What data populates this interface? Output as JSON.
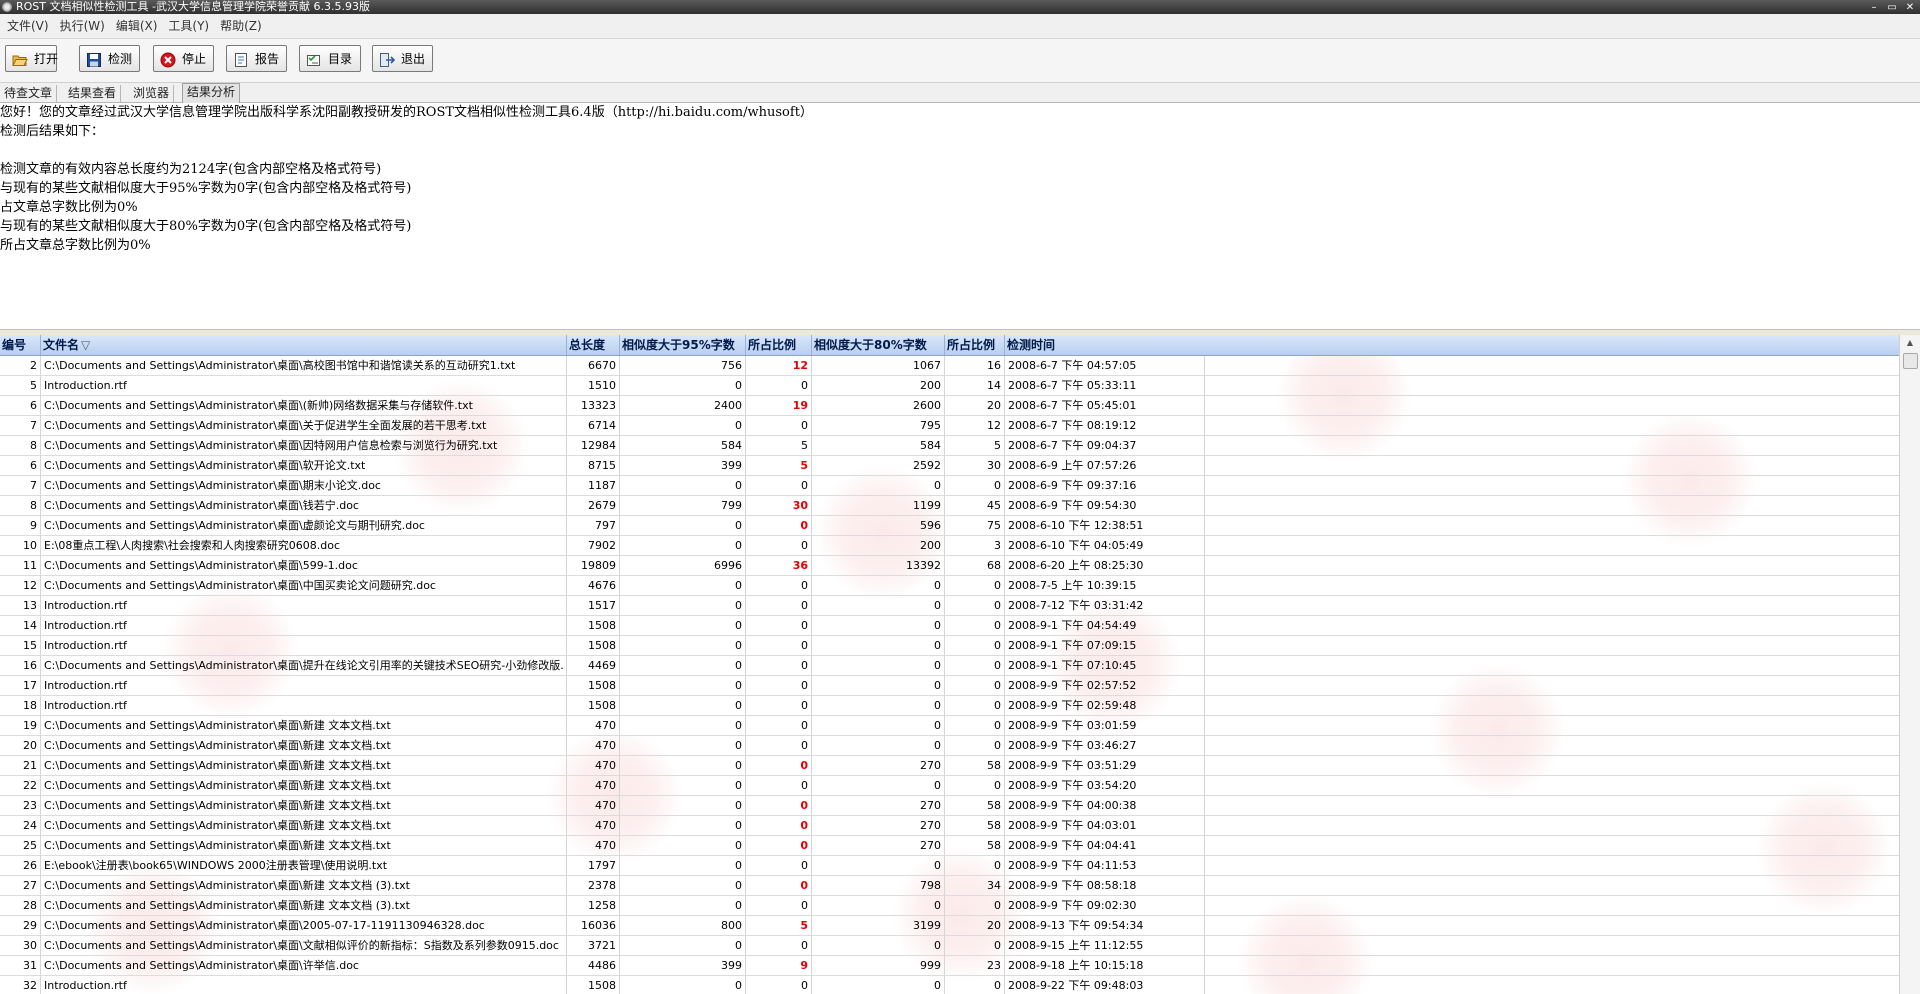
{
  "window": {
    "title": "ROST 文档相似性检测工具 -武汉大学信息管理学院荣誉贡献 6.3.5.93版",
    "controls": [
      "–",
      "▭",
      "✕"
    ]
  },
  "menu": [
    {
      "name": "file",
      "label": "文件(V)"
    },
    {
      "name": "execute",
      "label": "执行(W)"
    },
    {
      "name": "edit",
      "label": "编辑(X)"
    },
    {
      "name": "tools",
      "label": "工具(Y)"
    },
    {
      "name": "help",
      "label": "帮助(Z)"
    }
  ],
  "toolbar": [
    {
      "name": "open",
      "label": "打开",
      "icon": "folder-open-icon"
    },
    {
      "name": "detect",
      "label": "检测",
      "icon": "floppy-icon"
    },
    {
      "name": "stop",
      "label": "停止",
      "icon": "stop-icon"
    },
    {
      "name": "report",
      "label": "报告",
      "icon": "report-icon"
    },
    {
      "name": "catalog",
      "label": "目录",
      "icon": "catalog-icon"
    },
    {
      "name": "exit",
      "label": "退出",
      "icon": "exit-icon"
    }
  ],
  "tabs": [
    {
      "name": "pending",
      "label": "待查文章",
      "active": false
    },
    {
      "name": "results-view",
      "label": "结果查看",
      "active": false
    },
    {
      "name": "browser",
      "label": "浏览器",
      "active": false
    },
    {
      "name": "results-analysis",
      "label": "结果分析",
      "active": true
    }
  ],
  "result_text": [
    "您好！您的文章经过武汉大学信息管理学院出版科学系沈阳副教授研发的ROST文档相似性检测工具6.4版（http://hi.baidu.com/whusoft）",
    "检测后结果如下：",
    "",
    "检测文章的有效内容总长度约为2124字(包含内部空格及格式符号)",
    "与现有的某些文献相似度大于95%字数为0字(包含内部空格及格式符号)",
    "占文章总字数比例为0%",
    "与现有的某些文献相似度大于80%字数为0字(包含内部空格及格式符号)",
    "所占文章总字数比例为0%"
  ],
  "table": {
    "columns": [
      "编号",
      "文件名",
      "总长度",
      "相似度大于95%字数",
      "所占比例",
      "相似度大于80%字数",
      "所占比例",
      "检测时间"
    ],
    "sort_indicator": "▽",
    "highlight_color": "#e60000",
    "rows": [
      [
        "2",
        "C:\\Documents and Settings\\Administrator\\桌面\\高校图书馆中和谐馆读关系的互动研究1.txt",
        "6670",
        "756",
        "12",
        "1067",
        "16",
        "2008-6-7 下午 04:57:05",
        true
      ],
      [
        "5",
        "Introduction.rtf",
        "1510",
        "0",
        "0",
        "200",
        "14",
        "2008-6-7 下午 05:33:11",
        false
      ],
      [
        "6",
        "C:\\Documents and Settings\\Administrator\\桌面\\(新帅)网络数据采集与存储软件.txt",
        "13323",
        "2400",
        "19",
        "2600",
        "20",
        "2008-6-7 下午 05:45:01",
        true
      ],
      [
        "7",
        "C:\\Documents and Settings\\Administrator\\桌面\\关于促进学生全面发展的若干思考.txt",
        "6714",
        "0",
        "0",
        "795",
        "12",
        "2008-6-7 下午 08:19:12",
        false
      ],
      [
        "8",
        "C:\\Documents and Settings\\Administrator\\桌面\\因特网用户信息检索与浏览行为研究.txt",
        "12984",
        "584",
        "5",
        "584",
        "5",
        "2008-6-7 下午 09:04:37",
        false
      ],
      [
        "6",
        "C:\\Documents and Settings\\Administrator\\桌面\\软开论文.txt",
        "8715",
        "399",
        "5",
        "2592",
        "30",
        "2008-6-9 上午 07:57:26",
        true
      ],
      [
        "7",
        "C:\\Documents and Settings\\Administrator\\桌面\\期末小论文.doc",
        "1187",
        "0",
        "0",
        "0",
        "0",
        "2008-6-9 下午 09:37:16",
        false
      ],
      [
        "8",
        "C:\\Documents and Settings\\Administrator\\桌面\\钱若宁.doc",
        "2679",
        "799",
        "30",
        "1199",
        "45",
        "2008-6-9 下午 09:54:30",
        true
      ],
      [
        "9",
        "C:\\Documents and Settings\\Administrator\\桌面\\虚颜论文与期刊研究.doc",
        "797",
        "0",
        "0",
        "596",
        "75",
        "2008-6-10 下午 12:38:51",
        true
      ],
      [
        "10",
        "E:\\08重点工程\\人肉搜索\\社会搜索和人肉搜索研究0608.doc",
        "7902",
        "0",
        "0",
        "200",
        "3",
        "2008-6-10 下午 04:05:49",
        false
      ],
      [
        "11",
        "C:\\Documents and Settings\\Administrator\\桌面\\599-1.doc",
        "19809",
        "6996",
        "36",
        "13392",
        "68",
        "2008-6-20 上午 08:25:30",
        true
      ],
      [
        "12",
        "C:\\Documents and Settings\\Administrator\\桌面\\中国买卖论文问题研究.doc",
        "4676",
        "0",
        "0",
        "0",
        "0",
        "2008-7-5 上午 10:39:15",
        false
      ],
      [
        "13",
        "Introduction.rtf",
        "1517",
        "0",
        "0",
        "0",
        "0",
        "2008-7-12 下午 03:31:42",
        false
      ],
      [
        "14",
        "Introduction.rtf",
        "1508",
        "0",
        "0",
        "0",
        "0",
        "2008-9-1 下午 04:54:49",
        false
      ],
      [
        "15",
        "Introduction.rtf",
        "1508",
        "0",
        "0",
        "0",
        "0",
        "2008-9-1 下午 07:09:15",
        false
      ],
      [
        "16",
        "C:\\Documents and Settings\\Administrator\\桌面\\提升在线论文引用率的关键技术SEO研究-小劲修改版.",
        "4469",
        "0",
        "0",
        "0",
        "0",
        "2008-9-1 下午 07:10:45",
        false
      ],
      [
        "17",
        "Introduction.rtf",
        "1508",
        "0",
        "0",
        "0",
        "0",
        "2008-9-9 下午 02:57:52",
        false
      ],
      [
        "18",
        "Introduction.rtf",
        "1508",
        "0",
        "0",
        "0",
        "0",
        "2008-9-9 下午 02:59:48",
        false
      ],
      [
        "19",
        "C:\\Documents and Settings\\Administrator\\桌面\\新建 文本文档.txt",
        "470",
        "0",
        "0",
        "0",
        "0",
        "2008-9-9 下午 03:01:59",
        false
      ],
      [
        "20",
        "C:\\Documents and Settings\\Administrator\\桌面\\新建 文本文档.txt",
        "470",
        "0",
        "0",
        "0",
        "0",
        "2008-9-9 下午 03:46:27",
        false
      ],
      [
        "21",
        "C:\\Documents and Settings\\Administrator\\桌面\\新建 文本文档.txt",
        "470",
        "0",
        "0",
        "270",
        "58",
        "2008-9-9 下午 03:51:29",
        true
      ],
      [
        "22",
        "C:\\Documents and Settings\\Administrator\\桌面\\新建 文本文档.txt",
        "470",
        "0",
        "0",
        "0",
        "0",
        "2008-9-9 下午 03:54:20",
        false
      ],
      [
        "23",
        "C:\\Documents and Settings\\Administrator\\桌面\\新建 文本文档.txt",
        "470",
        "0",
        "0",
        "270",
        "58",
        "2008-9-9 下午 04:00:38",
        true
      ],
      [
        "24",
        "C:\\Documents and Settings\\Administrator\\桌面\\新建 文本文档.txt",
        "470",
        "0",
        "0",
        "270",
        "58",
        "2008-9-9 下午 04:03:01",
        true
      ],
      [
        "25",
        "C:\\Documents and Settings\\Administrator\\桌面\\新建 文本文档.txt",
        "470",
        "0",
        "0",
        "270",
        "58",
        "2008-9-9 下午 04:04:41",
        true
      ],
      [
        "26",
        "E:\\ebook\\注册表\\book65\\WINDOWS 2000注册表管理\\使用说明.txt",
        "1797",
        "0",
        "0",
        "0",
        "0",
        "2008-9-9 下午 04:11:53",
        false
      ],
      [
        "27",
        "C:\\Documents and Settings\\Administrator\\桌面\\新建 文本文档 (3).txt",
        "2378",
        "0",
        "0",
        "798",
        "34",
        "2008-9-9 下午 08:58:18",
        true
      ],
      [
        "28",
        "C:\\Documents and Settings\\Administrator\\桌面\\新建 文本文档 (3).txt",
        "1258",
        "0",
        "0",
        "0",
        "0",
        "2008-9-9 下午 09:02:30",
        false
      ],
      [
        "29",
        "C:\\Documents and Settings\\Administrator\\桌面\\2005-07-17-1191130946328.doc",
        "16036",
        "800",
        "5",
        "3199",
        "20",
        "2008-9-13 下午 09:54:34",
        true
      ],
      [
        "30",
        "C:\\Documents and Settings\\Administrator\\桌面\\文献相似评价的新指标：S指数及系列参数0915.doc",
        "3721",
        "0",
        "0",
        "0",
        "0",
        "2008-9-15 上午 11:12:55",
        false
      ],
      [
        "31",
        "C:\\Documents and Settings\\Administrator\\桌面\\许举信.doc",
        "4486",
        "399",
        "9",
        "999",
        "23",
        "2008-9-18 上午 10:15:18",
        true
      ],
      [
        "32",
        "Introduction.rtf",
        "1508",
        "0",
        "0",
        "0",
        "0",
        "2008-9-22 下午 09:48:03",
        false
      ]
    ]
  }
}
